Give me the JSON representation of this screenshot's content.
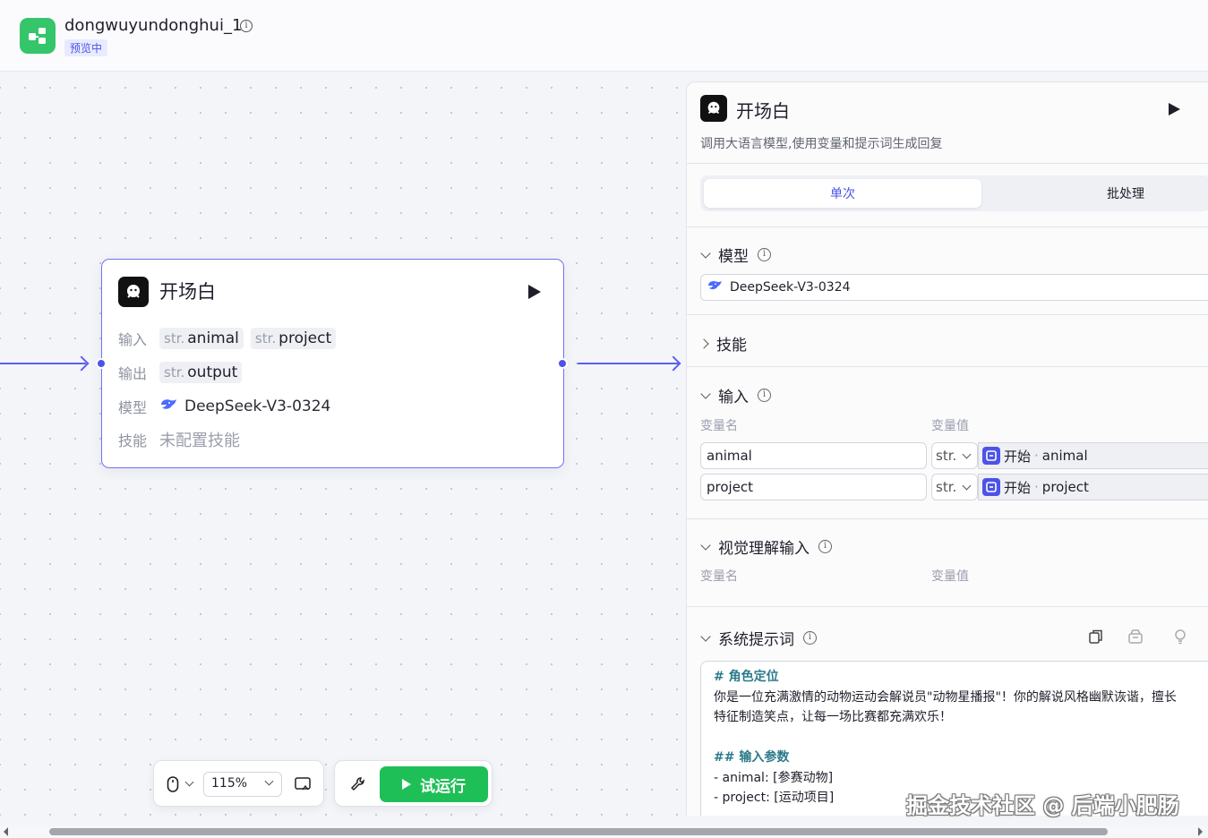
{
  "header": {
    "app_title": "dongwuyundonghui_1",
    "status_badge": "预览中"
  },
  "node": {
    "title": "开场白",
    "input_label": "输入",
    "inputs": [
      {
        "type": "str.",
        "name": "animal"
      },
      {
        "type": "str.",
        "name": "project"
      }
    ],
    "output_label": "输出",
    "outputs": [
      {
        "type": "str.",
        "name": "output"
      }
    ],
    "model_label": "模型",
    "model": "DeepSeek-V3-0324",
    "skill_label": "技能",
    "skill_value": "未配置技能"
  },
  "toolbar": {
    "zoom": "115%",
    "test_run_label": "试运行"
  },
  "panel": {
    "title": "开场白",
    "description": "调用大语言模型,使用变量和提示词生成回复",
    "tabs": [
      "单次",
      "批处理"
    ],
    "model_section": "模型",
    "model_value": "DeepSeek-V3-0324",
    "skill_section": "技能",
    "input_section": "输入",
    "col_var_name": "变量名",
    "col_var_value": "变量值",
    "input_rows": [
      {
        "name": "animal",
        "type": "str.",
        "source": "开始",
        "field": "animal"
      },
      {
        "name": "project",
        "type": "str.",
        "source": "开始",
        "field": "project"
      }
    ],
    "vision_section": "视觉理解输入",
    "system_prompt_section": "系统提示词",
    "prompt": {
      "h1": "# 角色定位",
      "p1": "你是一位充满激情的动物运动会解说员\"动物星播报\"！你的解说风格幽默诙谐，擅长",
      "p2": "特征制造笑点，让每一场比赛都充满欢乐！",
      "h2": "## 输入参数",
      "l1": "- animal: [参赛动物]",
      "l2": "- project: [运动项目]"
    }
  },
  "watermark": "掘金技术社区 @ 后端小肥肠",
  "colors": {
    "accent": "#4d53e8",
    "run_green": "#1fbf57",
    "logo_green": "#35c56b"
  }
}
